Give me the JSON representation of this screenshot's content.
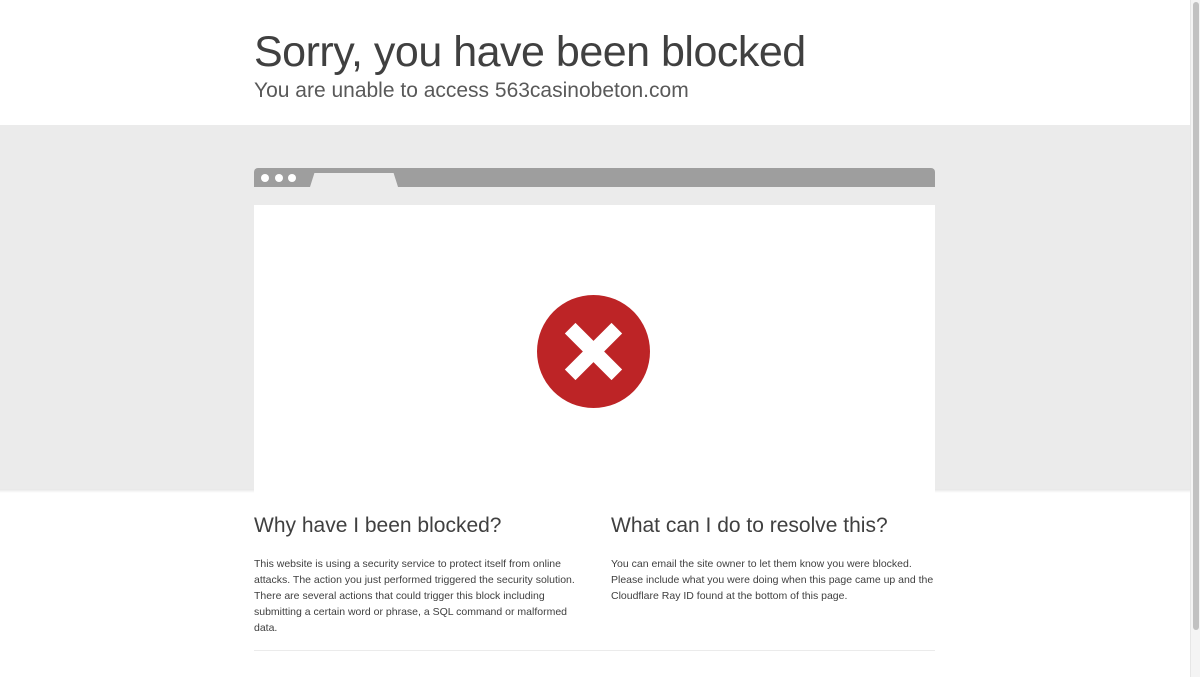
{
  "header": {
    "title": "Sorry, you have been blocked",
    "subtitle": "You are unable to access 563casinobeton.com"
  },
  "browser_mock": {
    "icon": "block-x-icon",
    "icon_color": "#bd2426"
  },
  "why_blocked": {
    "heading": "Why have I been blocked?",
    "body": "This website is using a security service to protect itself from online attacks. The action you just performed triggered the security solution. There are several actions that could trigger this block including submitting a certain word or phrase, a SQL command or malformed data."
  },
  "resolve": {
    "heading": "What can I do to resolve this?",
    "body": "You can email the site owner to let them know you were blocked. Please include what you were doing when this page came up and the Cloudflare Ray ID found at the bottom of this page."
  }
}
